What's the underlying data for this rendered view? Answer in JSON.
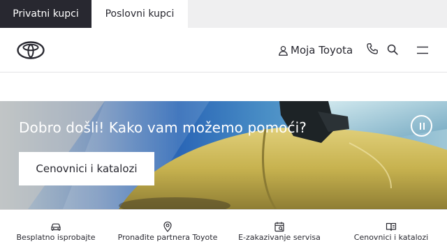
{
  "customer_tabs": {
    "private": "Privatni kupci",
    "business": "Poslovni kupci"
  },
  "header": {
    "logo": "toyota-logo",
    "account_label": "Moja Toyota",
    "icons": [
      "user-icon",
      "phone-icon",
      "search-icon",
      "menu-icon"
    ]
  },
  "hero": {
    "title": "Dobro došli! Kako vam možemo pomoći?",
    "cta_label": "Cenovnici i katalozi",
    "pause_icon": "pause-icon"
  },
  "bottom_nav": {
    "items": [
      {
        "label": "Besplatno isprobajte",
        "icon": "car-icon"
      },
      {
        "label": "Pronađite partnera Toyote",
        "icon": "map-pin-icon"
      },
      {
        "label": "E-zakazivanje servisa",
        "icon": "calendar-icon"
      },
      {
        "label": "Cenovnici i katalozi",
        "icon": "book-icon"
      }
    ]
  },
  "colors": {
    "dark": "#282830",
    "light_bar": "#efeff0",
    "hero_car": "#c8b354",
    "hero_blue": "#1f5fae"
  }
}
